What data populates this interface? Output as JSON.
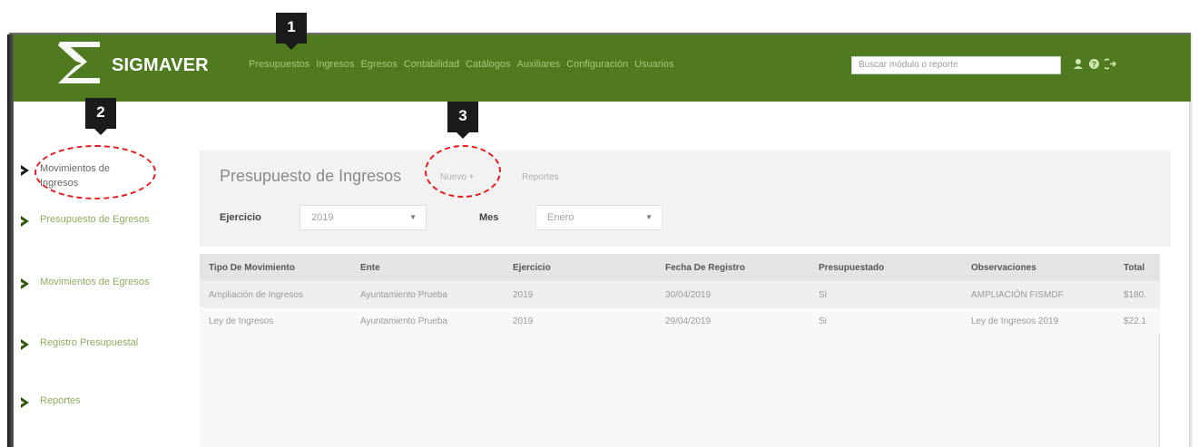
{
  "app": {
    "brand": "SIGMAVER",
    "nav_items": [
      "Presupuestos",
      "Ingresos",
      "Egresos",
      "Contabilidad",
      "Catálogos",
      "Auxiliares",
      "Configuración",
      "Usuarios"
    ],
    "search_placeholder": "Buscar módulo o reporte",
    "icons": [
      "user-icon",
      "help-icon",
      "logout-icon"
    ]
  },
  "callouts": [
    "1",
    "2",
    "3"
  ],
  "sidebar": {
    "items": [
      {
        "label_line1": "Movimientos de",
        "label_line2": "Ingresos",
        "active": true
      },
      {
        "label_line1": "Presupuesto de Egresos",
        "label_line2": ""
      },
      {
        "label_line1": "Movimientos de Egresos",
        "label_line2": ""
      },
      {
        "label_line1": "Registro Presupuestal",
        "label_line2": ""
      },
      {
        "label_line1": "Reportes",
        "label_line2": ""
      }
    ]
  },
  "panel": {
    "title": "Presupuesto de Ingresos",
    "nuevo_link": "Nuevo +",
    "reportes_link": "Reportes",
    "ejercicio_label": "Ejercicio",
    "ejercicio_value": "2019",
    "mes_label": "Mes",
    "mes_value": "Enero"
  },
  "table": {
    "headers": [
      "Tipo De Movimiento",
      "Ente",
      "Ejercicio",
      "Fecha De Registro",
      "Presupuestado",
      "Observaciones",
      "Total"
    ],
    "rows": [
      [
        "Ampliación de Ingresos",
        "Ayuntamiento Prueba",
        "2019",
        "30/04/2019",
        "Si",
        "AMPLIACIÓN FISMDF",
        "$180."
      ],
      [
        "Ley de Ingresos",
        "Ayuntamiento Prueba",
        "2019",
        "29/04/2019",
        "Si",
        "Ley de Ingresos 2019",
        "$22.1"
      ]
    ]
  },
  "colors": {
    "header_green": "#4f7a1f",
    "nav_text": "#a6c97a",
    "sidebar_text": "#8aae5c",
    "callout_bg": "#1b1b1b",
    "highlight_red": "#e81c1c"
  }
}
